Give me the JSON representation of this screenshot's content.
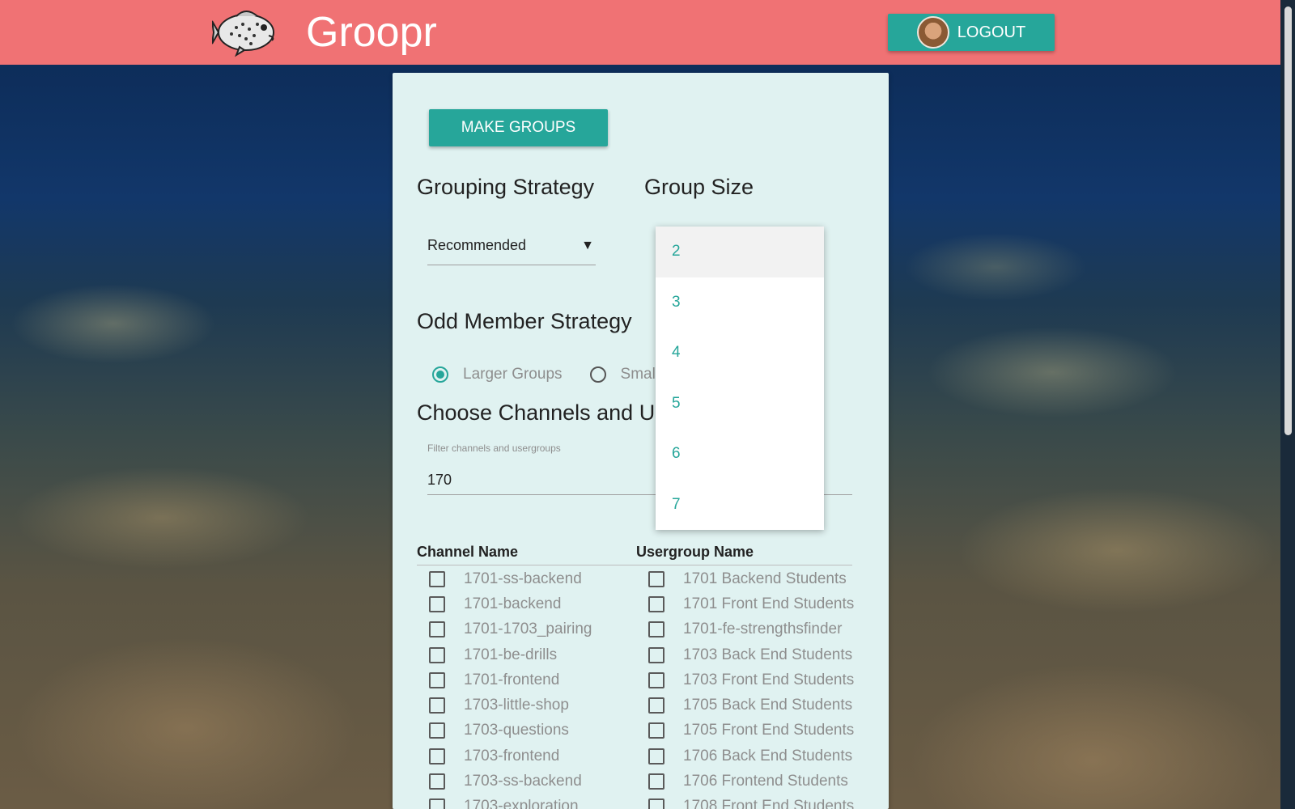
{
  "app": {
    "name": "Groopr"
  },
  "header": {
    "logout_label": "LOGOUT"
  },
  "actions": {
    "make_groups_label": "MAKE GROUPS"
  },
  "grouping": {
    "title": "Grouping Strategy",
    "selected": "Recommended"
  },
  "group_size": {
    "title": "Group Size",
    "options": [
      "2",
      "3",
      "4",
      "5",
      "6",
      "7"
    ],
    "highlighted": "2"
  },
  "odd_member": {
    "title": "Odd Member Strategy",
    "options": [
      {
        "label": "Larger Groups",
        "checked": true
      },
      {
        "label": "Small",
        "checked": false
      }
    ]
  },
  "channels": {
    "title": "Choose Channels and U",
    "filter_label": "Filter channels and usergroups",
    "filter_value": "170",
    "channel_header": "Channel Name",
    "usergroup_header": "Usergroup Name",
    "channel_items": [
      "1701-ss-backend",
      "1701-backend",
      "1701-1703_pairing",
      "1701-be-drills",
      "1701-frontend",
      "1703-little-shop",
      "1703-questions",
      "1703-frontend",
      "1703-ss-backend",
      "1703-exploration"
    ],
    "usergroup_items": [
      "1701 Backend Students",
      "1701 Front End Students",
      "1701-fe-strengthsfinder",
      "1703 Back End Students",
      "1703 Front End Students",
      "1705 Back End Students",
      "1705 Front End Students",
      "1706 Back End Students",
      "1706 Frontend Students",
      "1708 Front End Students"
    ]
  },
  "colors": {
    "header": "#f07274",
    "accent": "#26a69a",
    "card": "#e0f2f1"
  },
  "icons": {
    "logo": "fish-icon",
    "avatar": "user-avatar",
    "select_arrow": "triangle-down-icon"
  }
}
